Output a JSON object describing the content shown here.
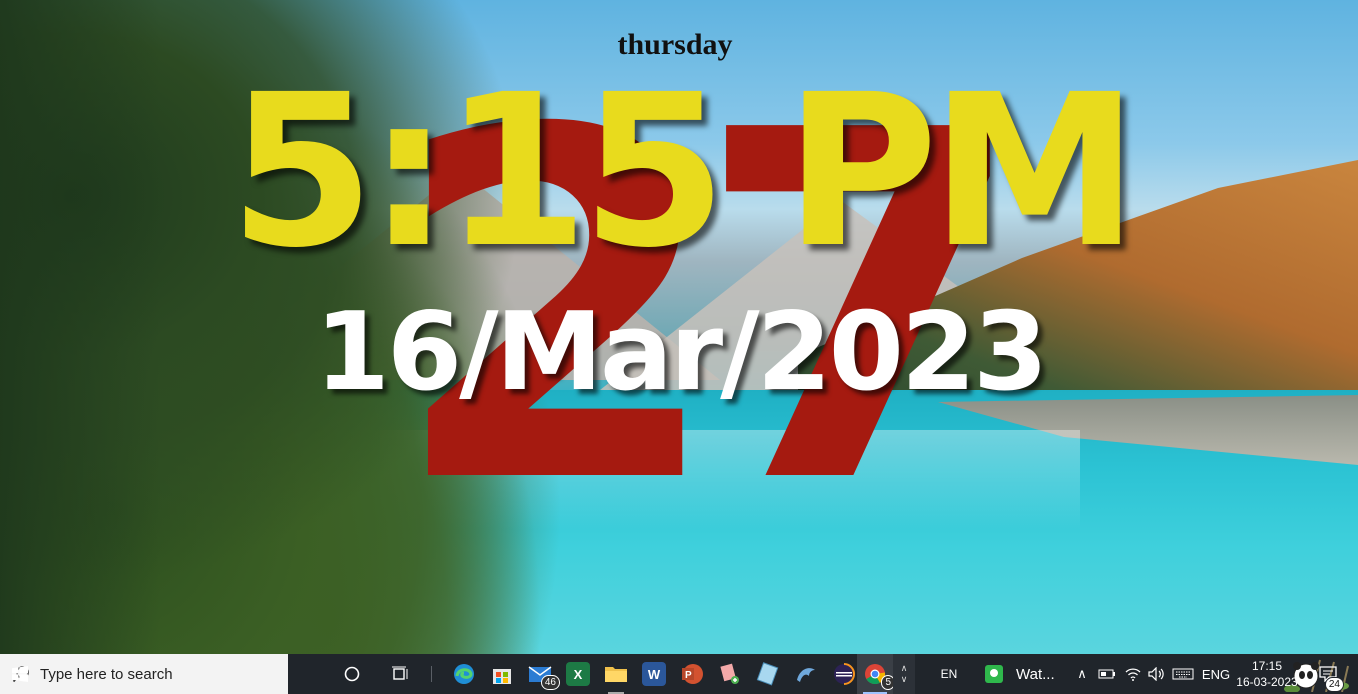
{
  "widget": {
    "day_name": "thursday",
    "day_number": "27",
    "time": "5:15 PM",
    "date": "16/Mar/2023"
  },
  "taskbar": {
    "search_placeholder": "Type here to search",
    "mail_badge": "46",
    "chrome_badge": "5",
    "input_indicator": "EN",
    "running_app_label": "Wat...",
    "language": "ENG",
    "clock_time": "17:15",
    "clock_date": "16-03-2023",
    "notification_count": "24"
  },
  "icons": [
    "windows-start-icon",
    "search-icon",
    "cortana-icon",
    "task-view-icon",
    "edge-icon",
    "store-icon",
    "mail-icon",
    "excel-icon",
    "file-explorer-icon",
    "word-icon",
    "powerpoint-icon",
    "snip-tool-icon",
    "notepad-icon",
    "dolphin-icon",
    "eclipse-icon",
    "chrome-icon",
    "chevron-up-icon",
    "chevron-down-icon",
    "whatsapp-icon",
    "show-hidden-icons-icon",
    "battery-icon",
    "wifi-icon",
    "volume-icon",
    "keyboard-icon",
    "notifications-icon"
  ],
  "colors": {
    "time": "#e8db1d",
    "day_number": "#a51a10",
    "date": "#ffffff",
    "taskbar": "#20252b",
    "search_box": "#f3f3f3"
  }
}
